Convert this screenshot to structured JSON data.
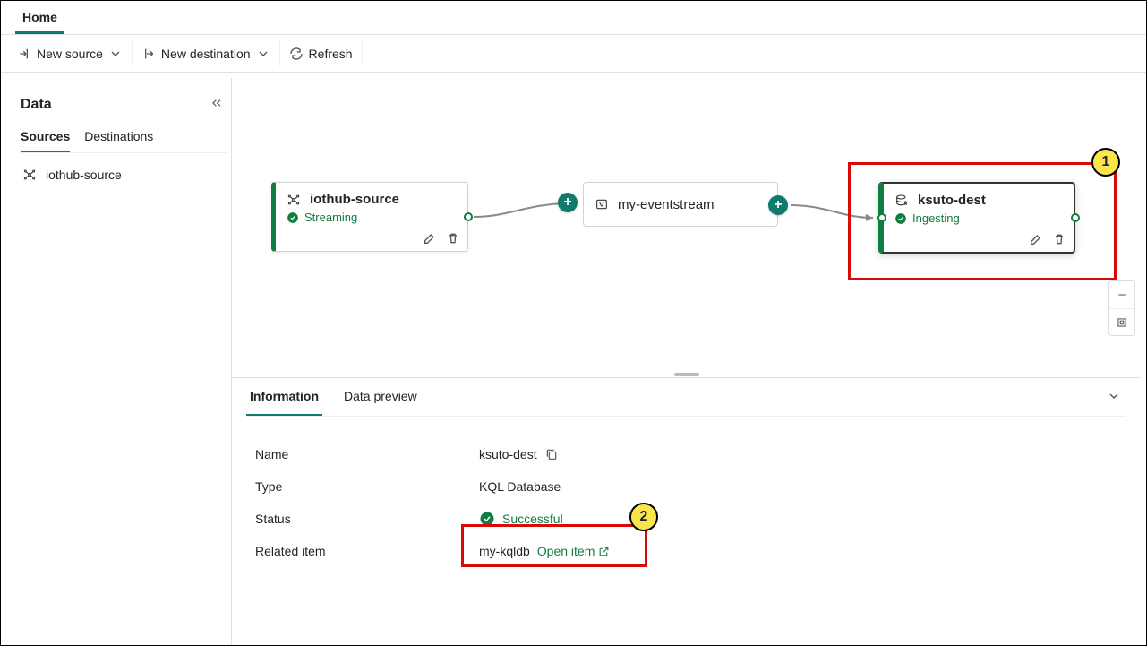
{
  "topTabs": {
    "home": "Home"
  },
  "toolbar": {
    "newSource": "New source",
    "newDestination": "New destination",
    "refresh": "Refresh"
  },
  "sidebar": {
    "title": "Data",
    "tabs": {
      "sources": "Sources",
      "destinations": "Destinations"
    },
    "items": [
      {
        "label": "iothub-source"
      }
    ]
  },
  "canvas": {
    "source": {
      "title": "iothub-source",
      "status": "Streaming"
    },
    "stream": {
      "title": "my-eventstream"
    },
    "dest": {
      "title": "ksuto-dest",
      "status": "Ingesting"
    }
  },
  "bottom": {
    "tabs": {
      "info": "Information",
      "preview": "Data preview"
    },
    "rows": {
      "nameLabel": "Name",
      "nameValue": "ksuto-dest",
      "typeLabel": "Type",
      "typeValue": "KQL Database",
      "statusLabel": "Status",
      "statusValue": "Successful",
      "relatedLabel": "Related item",
      "relatedValue": "my-kqldb",
      "openItem": "Open item"
    }
  },
  "callouts": {
    "one": "1",
    "two": "2"
  }
}
